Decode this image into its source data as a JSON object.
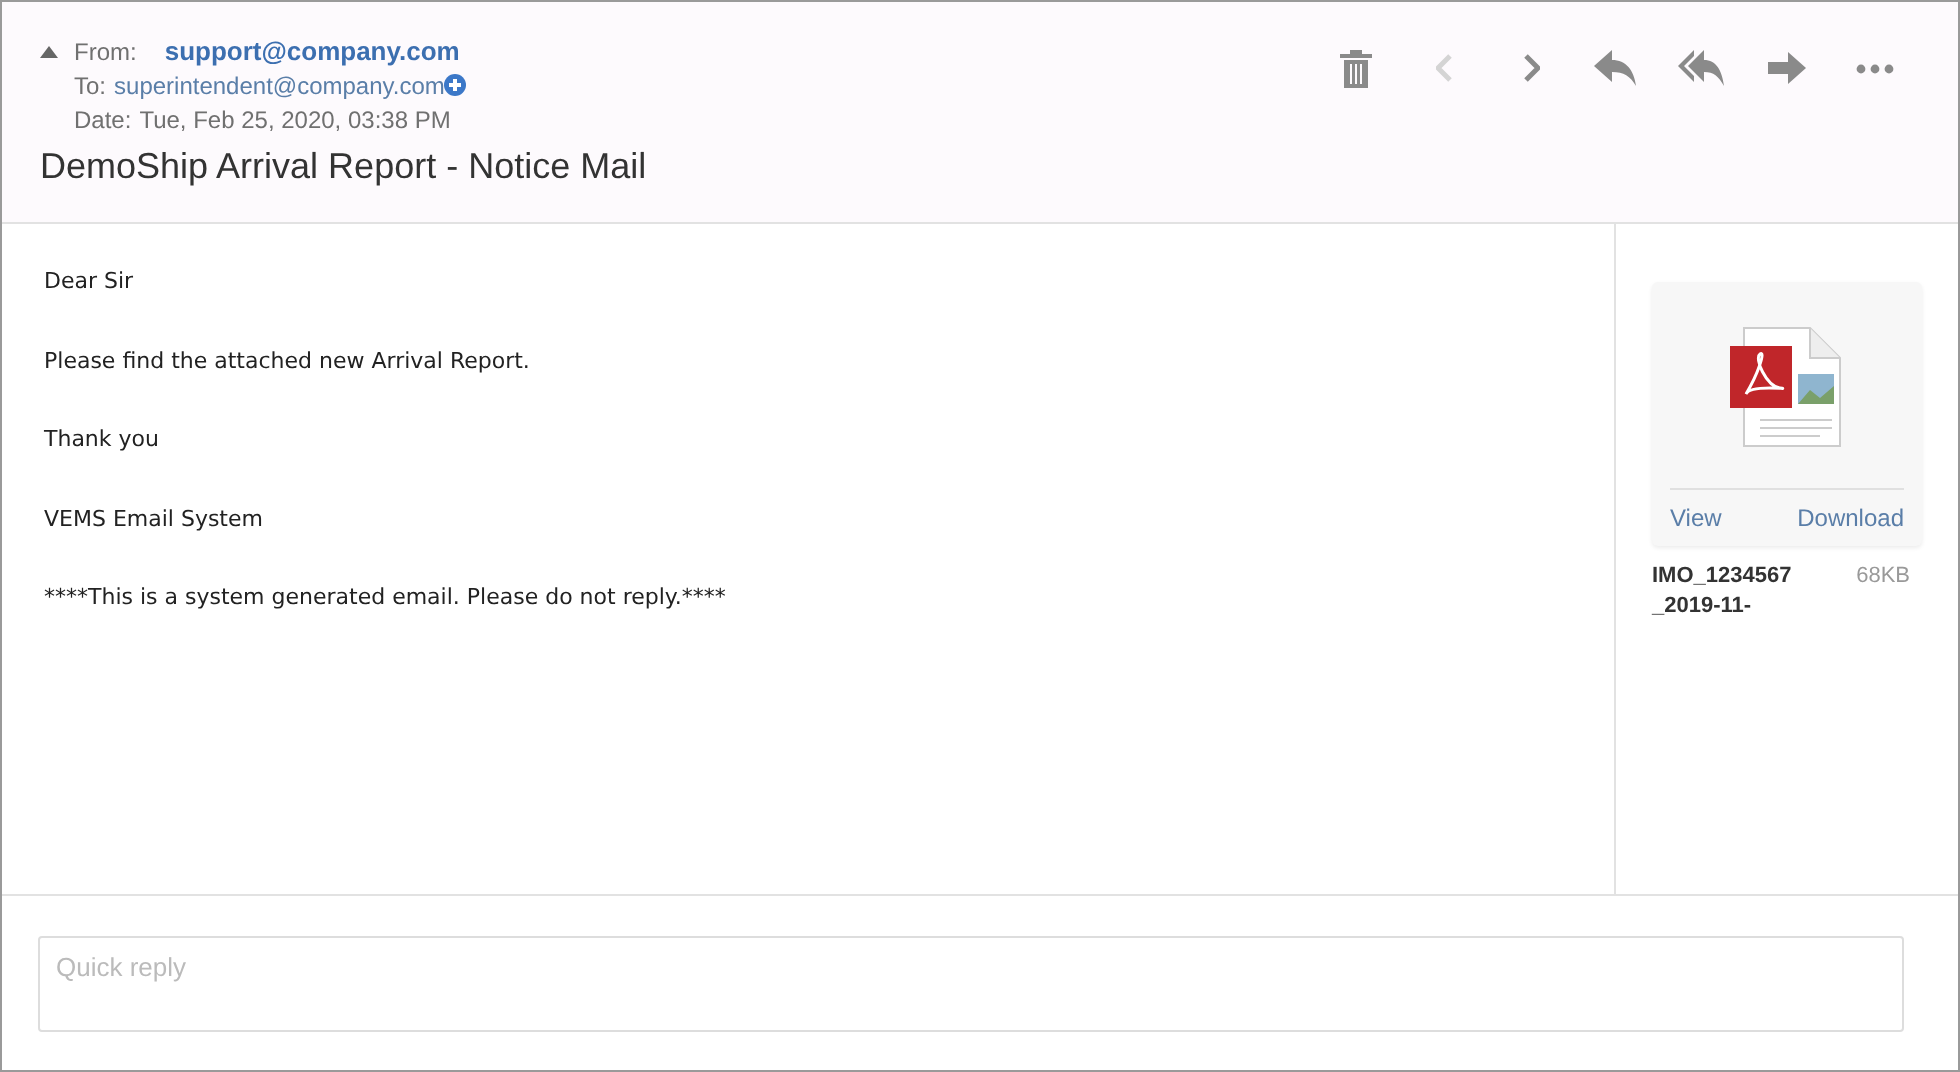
{
  "header": {
    "from_label": "From:",
    "from": "support@company.com",
    "to_label": "To:",
    "to": "superintendent@company.com",
    "date_label": "Date:",
    "date": "Tue, Feb 25, 2020, 03:38 PM",
    "subject": "DemoShip Arrival Report - Notice Mail",
    "expanded": true
  },
  "toolbar": [
    {
      "kind": "delete",
      "disabled": false
    },
    {
      "kind": "previous",
      "disabled": true
    },
    {
      "kind": "next",
      "disabled": false
    },
    {
      "kind": "reply",
      "disabled": false
    },
    {
      "kind": "reply-all",
      "disabled": false
    },
    {
      "kind": "forward",
      "disabled": false
    },
    {
      "kind": "more",
      "disabled": false
    }
  ],
  "body": [
    "Dear Sir",
    "Please find the attached new Arrival Report.",
    "Thank you",
    "VEMS Email System",
    "****This is a system generated email. Please do not reply.****"
  ],
  "attachment": {
    "view": "View",
    "download": "Download",
    "name": "IMO_1234567\n_2019-11-",
    "size": "68KB"
  },
  "quick_reply": {
    "placeholder": "Quick reply"
  }
}
